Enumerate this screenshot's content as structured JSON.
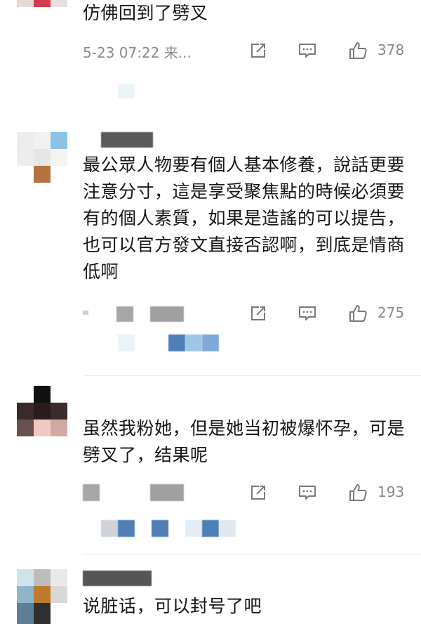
{
  "comments": [
    {
      "text": "仿佛回到了劈叉",
      "time": "5-23 07:22 来...",
      "likes": "378"
    },
    {
      "text": "最公眾人物要有個人基本修養，說話更要注意分寸，這是享受聚焦點的時候必須要有的個人素質，如果是造謠的可以提告，也可以官方發文直接否認啊，到底是情商低啊",
      "likes": "275"
    },
    {
      "text": "虽然我粉她，但是她当初被爆怀孕，可是劈叉了，结果呢",
      "likes": "193"
    },
    {
      "text": "说脏话，可以封号了吧"
    }
  ],
  "icons": {
    "share": "share-icon",
    "reply": "comment-icon",
    "like": "thumbs-up-icon"
  },
  "colors": {
    "text": "#161616",
    "meta": "#8a8a8a",
    "icon_stroke": "#7a7a7a"
  }
}
